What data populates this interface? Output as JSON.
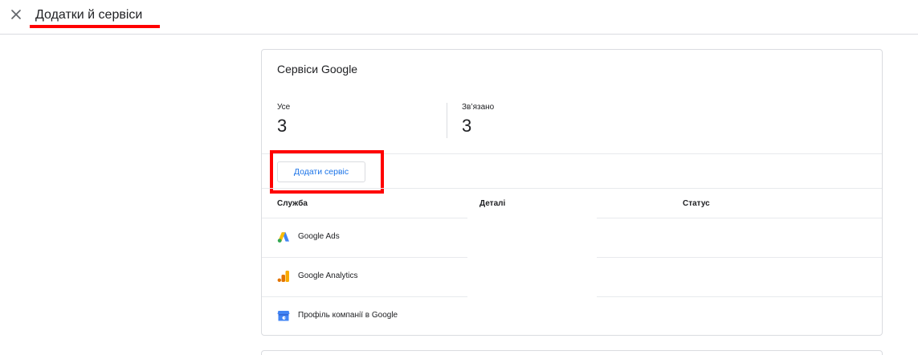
{
  "header": {
    "title": "Додатки й сервіси"
  },
  "card": {
    "title": "Сервіси Google",
    "stats": {
      "all_label": "Усе",
      "all_value": "3",
      "linked_label": "Зв’язано",
      "linked_value": "3"
    },
    "add_button": "Додати сервіс",
    "columns": {
      "service": "Служба",
      "details": "Деталі",
      "status": "Статус"
    },
    "rows": [
      {
        "label": "Google Ads",
        "icon": "google-ads-icon"
      },
      {
        "label": "Google Analytics",
        "icon": "google-analytics-icon"
      },
      {
        "label": "Профіль компанії в Google",
        "icon": "business-profile-icon"
      }
    ]
  },
  "colors": {
    "accent": "#1a73e8",
    "highlight": "#ff0000",
    "border": "#dadce0"
  }
}
